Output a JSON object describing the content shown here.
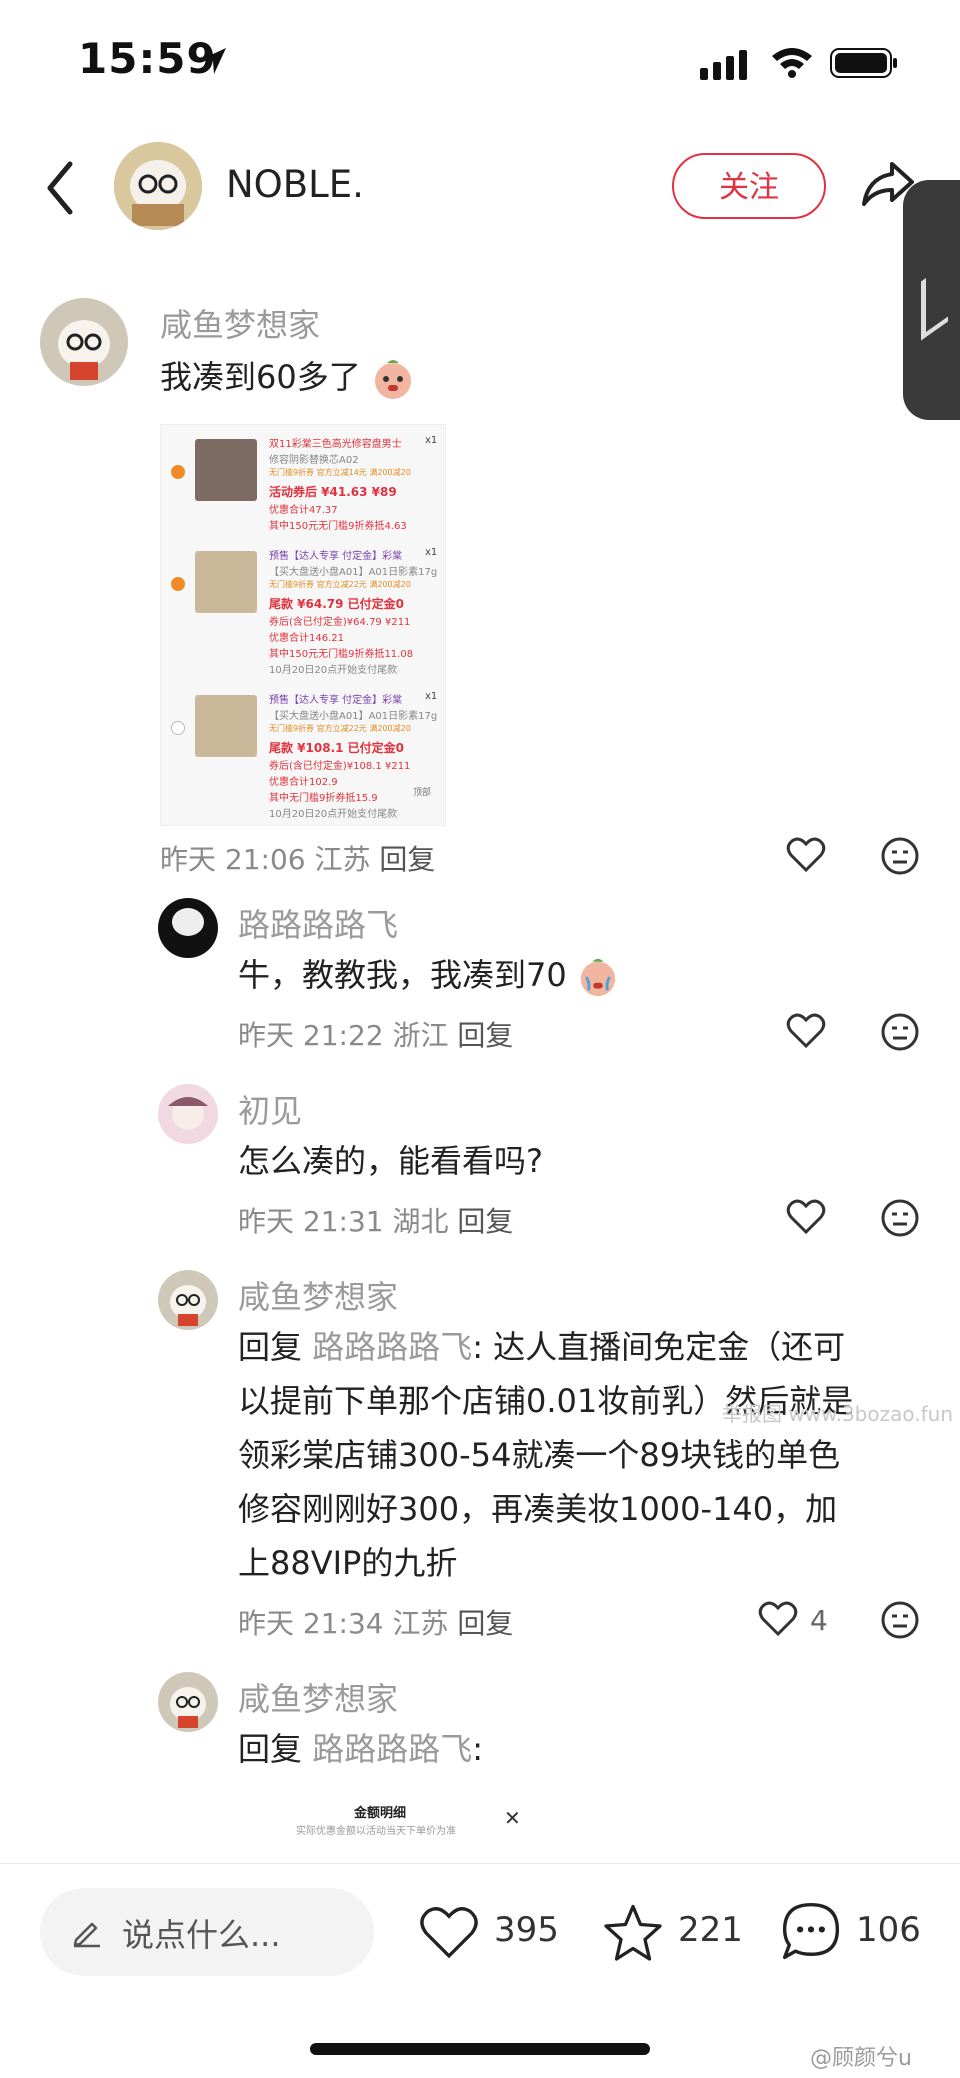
{
  "status_bar": {
    "time": "15:59"
  },
  "header": {
    "author_name": "NOBLE.",
    "follow_label": "关注"
  },
  "comments": [
    {
      "user": "咸鱼梦想家",
      "text": "我凑到60多了",
      "meta": "昨天 21:06 江苏",
      "reply_label": "回复",
      "has_image": true
    },
    {
      "user": "路路路路飞",
      "text": "牛，教教我，我凑到70",
      "meta": "昨天 21:22 浙江",
      "reply_label": "回复"
    },
    {
      "user": "初见",
      "text": "怎么凑的，能看看吗?",
      "meta": "昨天 21:31 湖北",
      "reply_label": "回复"
    },
    {
      "user": "咸鱼梦想家",
      "reply_prefix": "回复",
      "reply_to": "路路路路飞",
      "text_lines": [
        ": 达人直播间免定金（还可",
        "以提前下单那个店铺0.01妆前乳）然后就是",
        "领彩棠店铺300-54就凑一个89块钱的单色",
        "修容刚刚好300，再凑美妆1000-140，加",
        "上88VIP的九折"
      ],
      "meta": "昨天 21:34 江苏",
      "reply_label": "回复",
      "likes": "4"
    },
    {
      "user": "咸鱼梦想家",
      "reply_prefix": "回复",
      "reply_to": "路路路路飞",
      "text": ":"
    }
  ],
  "attached_image": {
    "rows": [
      {
        "title": "双11彩棠三色高光修容盘男士",
        "qty": "x1",
        "spec": "修容阴影替换芯A02",
        "tags": "无门槛9折券  官方立减14元  满200减20",
        "price": "活动券后 ¥41.63 ¥89",
        "line1": "优惠合计47.37",
        "line2": "其中150元无门槛9折券抵4.63"
      },
      {
        "title": "预售【达人专享 付定金】彩棠",
        "qty": "x1",
        "spec": "【买大盘送小盘A01】A01日影素17g",
        "tags": "无门槛9折券  官方立减22元  满200减20",
        "price": "尾款 ¥64.79 已付定金0",
        "line1": "券后(含已付定金)¥64.79 ¥211",
        "line2": "优惠合计146.21",
        "line3": "其中150元无门槛9折券抵11.08",
        "line4": "10月20日20点开始支付尾款"
      },
      {
        "title": "预售【达人专享 付定金】彩棠",
        "qty": "x1",
        "spec": "【买大盘送小盘A01】A01日影素17g",
        "tags": "无门槛9折券  官方立减22元  满200减20",
        "price": "尾款 ¥108.1 已付定金0",
        "line1": "券后(含已付定金)¥108.1 ¥211",
        "line2": "优惠合计102.9",
        "line3": "其中无门槛9折券抵15.9",
        "line4": "10月20日20点开始支付尾款"
      }
    ],
    "top_label": "顶部"
  },
  "amount_panel": {
    "title": "金额明细",
    "subtitle": "实际优惠金额以活动当天下单价为准"
  },
  "watermark": {
    "text1": "举报图 www.3bozao.fun",
    "text2": "@顾颜兮u"
  },
  "bottom_bar": {
    "input_placeholder": "说点什么...",
    "likes": "395",
    "stars": "221",
    "comments": "106"
  },
  "colors": {
    "accent": "#e0333f",
    "muted": "#9a9a9a"
  }
}
